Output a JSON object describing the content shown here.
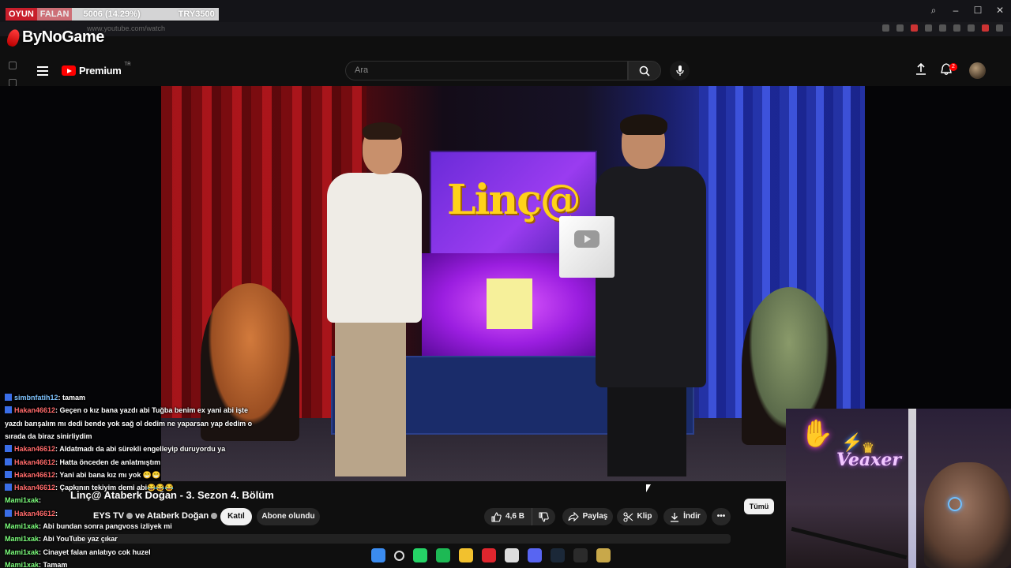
{
  "browser": {
    "url": "www.youtube.com/watch",
    "window_controls": [
      "search-icon",
      "minimize-icon",
      "maximize-icon",
      "close-icon"
    ]
  },
  "overlay": {
    "ticker": {
      "tag": "OYUN",
      "item": "FALAN",
      "stat": "5006 (14.29%)",
      "currency": "TRY3500"
    },
    "brand": "ByNoGame"
  },
  "youtube": {
    "logo_text": "Premium",
    "logo_country": "TR",
    "search_placeholder": "Ara",
    "notification_count": "2"
  },
  "video": {
    "title": "Linç@ Ataberk Doğan - 3. Sezon 4. Bölüm",
    "channel": "EYS TV",
    "channel_join": "ve Ataberk Doğan",
    "join_label": "Katıl",
    "subscribed_label": "Abone olundu",
    "likes": "4,6 B",
    "share_label": "Paylaş",
    "clip_label": "Klip",
    "download_label": "İndir",
    "filter_all": "Tümü"
  },
  "chat": [
    {
      "user": "simbnfatih12",
      "text": ": tamam",
      "color": "blue"
    },
    {
      "user": "Hakan46612",
      "text": ": Geçen o kız bana yazdı abi Tuğba benim ex yani abi işte",
      "color": "red"
    },
    {
      "user": "",
      "text": "yazdı barışalım mı dedi bende yok sağ ol dedim ne yaparsan yap dedim o",
      "color": "none"
    },
    {
      "user": "",
      "text": "sırada da biraz sinirliydim",
      "color": "none"
    },
    {
      "user": "Hakan46612",
      "text": ": Aldatmadı da abi sürekli engelleyip duruyordu ya",
      "color": "red"
    },
    {
      "user": "Hakan46612",
      "text": ": Hatta önceden de anlatmıştım",
      "color": "red"
    },
    {
      "user": "Hakan46612",
      "text": ": Yani abi bana kız mı yok 😁😁",
      "color": "red"
    },
    {
      "user": "Hakan46612",
      "text": ": Çapkının tekiyim demi abi😂😂😂",
      "color": "red"
    },
    {
      "user": "Mami1xak",
      "text": ":",
      "color": "green"
    },
    {
      "user": "Hakan46612",
      "text": ":",
      "color": "red"
    },
    {
      "user": "Mami1xak",
      "text": ": Abi bundan sonra pangvoss izliyek mi",
      "color": "green"
    },
    {
      "user": "Mami1xak",
      "text": ": Abi YouTube yaz çıkar",
      "color": "green"
    },
    {
      "user": "Mami1xak",
      "text": ": Cinayet falan anlatıyo cok huzel",
      "color": "green"
    },
    {
      "user": "Mami1xak",
      "text": ": Tamam",
      "color": "green"
    }
  ],
  "webcam": {
    "sign": "Veaxer"
  },
  "colors": {
    "youtube_red": "#ff0000",
    "chat_user_red": "#ff6a6a",
    "chat_user_green": "#7dff7d",
    "chat_user_blue": "#7fc4ff",
    "ticker_red": "#c81e2b"
  },
  "taskbar": [
    "windows-start-icon",
    "search-icon",
    "whatsapp-icon",
    "spotify-icon",
    "file-explorer-icon",
    "opera-gx-icon",
    "chrome-icon",
    "discord-icon",
    "steam-icon",
    "obs-icon",
    "league-icon"
  ]
}
